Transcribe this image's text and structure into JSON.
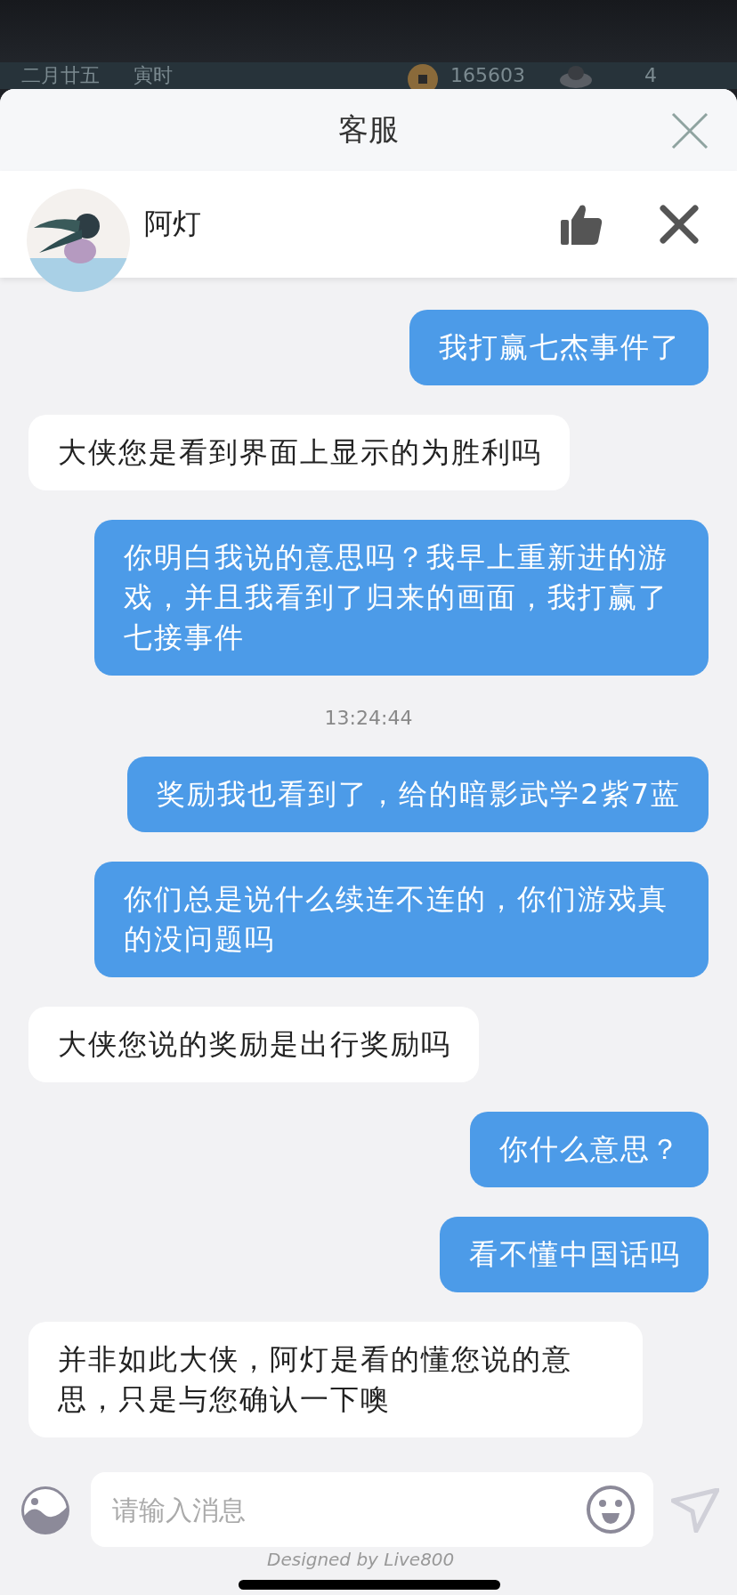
{
  "game_bar": {
    "date": "二月廿五",
    "hour": "寅时",
    "coins": "165603",
    "ingots": "4"
  },
  "header": {
    "title": "客服"
  },
  "agent": {
    "name": "阿灯"
  },
  "messages": [
    {
      "kind": "sent",
      "text": "我打赢七杰事件了"
    },
    {
      "kind": "received",
      "text": "大侠您是看到界面上显示的为胜利吗"
    },
    {
      "kind": "sent",
      "text": "你明白我说的意思吗？我早上重新进的游戏，并且我看到了归来的画面，我打赢了七接事件"
    },
    {
      "kind": "time",
      "text": "13:24:44"
    },
    {
      "kind": "sent",
      "text": "奖励我也看到了，给的暗影武学2紫7蓝"
    },
    {
      "kind": "sent",
      "text": "你们总是说什么续连不连的，你们游戏真的没问题吗"
    },
    {
      "kind": "received",
      "text": "大侠您说的奖励是出行奖励吗"
    },
    {
      "kind": "sent",
      "text": "你什么意思？"
    },
    {
      "kind": "sent",
      "text": "看不懂中国话吗"
    },
    {
      "kind": "received",
      "text": "并非如此大侠，阿灯是看的懂您说的意思，只是与您确认一下噢"
    }
  ],
  "input": {
    "placeholder": "请输入消息"
  },
  "footer": "Designed by Live800"
}
